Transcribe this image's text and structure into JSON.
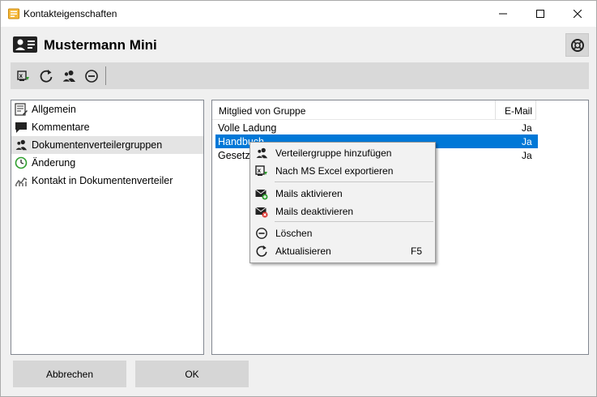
{
  "window": {
    "title": "Kontakteigenschaften"
  },
  "header": {
    "title": "Mustermann Mini"
  },
  "toolbar": {
    "icons": [
      "excel-export-icon",
      "refresh-icon",
      "users-icon",
      "minus-circle-icon"
    ]
  },
  "nav": {
    "items": [
      {
        "label": "Allgemein",
        "icon": "form-icon"
      },
      {
        "label": "Kommentare",
        "icon": "comment-icon"
      },
      {
        "label": "Dokumentenverteilergruppen",
        "icon": "users-icon",
        "selected": true
      },
      {
        "label": "Änderung",
        "icon": "clock-icon"
      },
      {
        "label": "Kontakt in Dokumentenverteiler",
        "icon": "chart-icon"
      }
    ]
  },
  "table": {
    "columns": [
      "Mitglied von Gruppe",
      "E-Mail"
    ],
    "rows": [
      {
        "group": "Volle Ladung",
        "email": "Ja"
      },
      {
        "group": "Handbuch",
        "email": "Ja",
        "selected": true
      },
      {
        "group": "Gesetz",
        "email": "Ja"
      }
    ]
  },
  "context_menu": {
    "items": [
      {
        "label": "Verteilergruppe hinzufügen",
        "icon": "users-icon"
      },
      {
        "label": "Nach MS Excel exportieren",
        "icon": "excel-export-icon"
      },
      {
        "label": "Mails aktivieren",
        "icon": "mail-enable-icon"
      },
      {
        "label": "Mails deaktivieren",
        "icon": "mail-disable-icon"
      },
      {
        "label": "Löschen",
        "icon": "minus-circle-icon"
      },
      {
        "label": "Aktualisieren",
        "icon": "refresh-icon",
        "shortcut": "F5"
      }
    ]
  },
  "buttons": {
    "cancel": "Abbrechen",
    "ok": "OK"
  },
  "colors": {
    "selection": "#0078d7",
    "toolbar": "#d9d9d9",
    "button": "#d6d6d6",
    "nav_selected": "#e4e4e4"
  }
}
